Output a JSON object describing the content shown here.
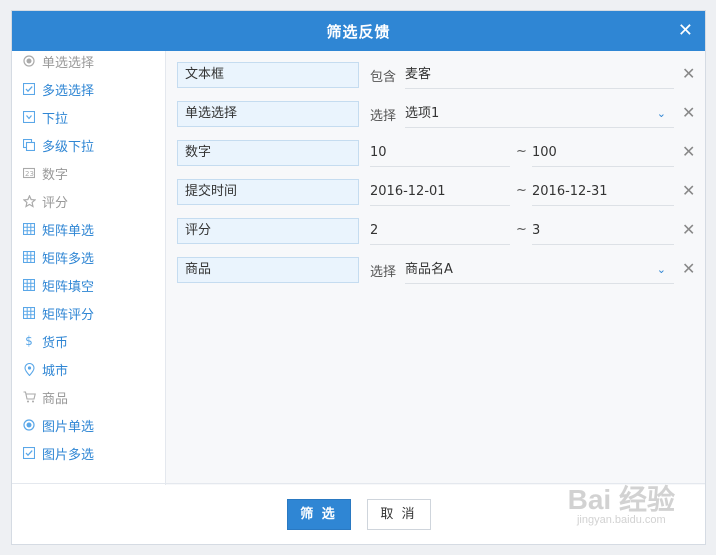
{
  "dialog": {
    "title": "筛选反馈"
  },
  "sidebar": {
    "items": [
      {
        "label": "单选选择",
        "icon": "radio-icon",
        "state": "gray"
      },
      {
        "label": "多选选择",
        "icon": "checkbox-icon",
        "state": "blue"
      },
      {
        "label": "下拉",
        "icon": "dropdown-icon",
        "state": "blue"
      },
      {
        "label": "多级下拉",
        "icon": "multi-dropdown-icon",
        "state": "blue"
      },
      {
        "label": "数字",
        "icon": "number-icon",
        "state": "gray"
      },
      {
        "label": "评分",
        "icon": "star-icon",
        "state": "gray"
      },
      {
        "label": "矩阵单选",
        "icon": "matrix-icon",
        "state": "blue"
      },
      {
        "label": "矩阵多选",
        "icon": "matrix-icon",
        "state": "blue"
      },
      {
        "label": "矩阵填空",
        "icon": "matrix-icon",
        "state": "blue"
      },
      {
        "label": "矩阵评分",
        "icon": "matrix-icon",
        "state": "blue"
      },
      {
        "label": "货币",
        "icon": "dollar-icon",
        "state": "blue"
      },
      {
        "label": "城市",
        "icon": "location-pin-icon",
        "state": "blue"
      },
      {
        "label": "商品",
        "icon": "cart-icon",
        "state": "gray"
      },
      {
        "label": "图片单选",
        "icon": "radio-icon",
        "state": "blue"
      },
      {
        "label": "图片多选",
        "icon": "checkbox-icon",
        "state": "blue"
      }
    ]
  },
  "filters": [
    {
      "field": "文本框",
      "op": "包含",
      "value": "麦客",
      "kind": "text"
    },
    {
      "field": "单选选择",
      "op": "选择",
      "value": "选项1",
      "kind": "select"
    },
    {
      "field": "数字",
      "from": "10",
      "tilde": "~",
      "to": "100",
      "kind": "range"
    },
    {
      "field": "提交时间",
      "from": "2016-12-01",
      "tilde": "~",
      "to": "2016-12-31",
      "kind": "range"
    },
    {
      "field": "评分",
      "from": "2",
      "tilde": "~",
      "to": "3",
      "kind": "range"
    },
    {
      "field": "商品",
      "op": "选择",
      "value": "商品名A",
      "kind": "select"
    }
  ],
  "footer": {
    "confirm_label": "筛 选",
    "cancel_label": "取 消"
  },
  "watermark": {
    "line1": "Bai 经验",
    "line2": "jingyan.baidu.com"
  },
  "colors": {
    "accent": "#2f86d4",
    "field_bg": "#eaf4fd",
    "sidebar_gray": "#999999"
  }
}
